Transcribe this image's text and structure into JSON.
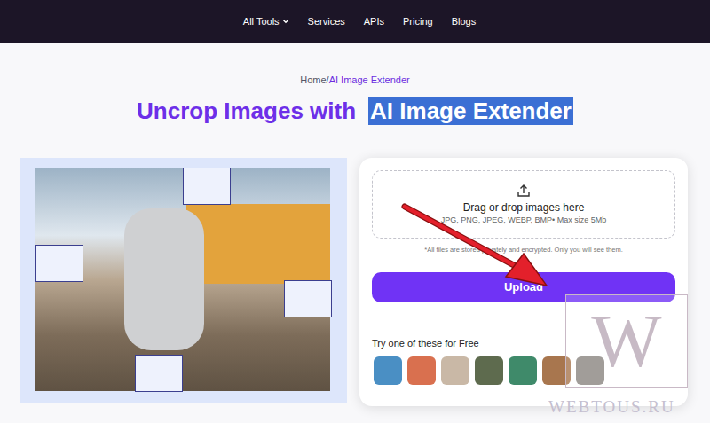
{
  "nav": {
    "items": [
      {
        "label": "All Tools",
        "dropdown": true
      },
      {
        "label": "Services",
        "dropdown": false
      },
      {
        "label": "APIs",
        "dropdown": false
      },
      {
        "label": "Pricing",
        "dropdown": false
      },
      {
        "label": "Blogs",
        "dropdown": false
      }
    ]
  },
  "breadcrumb": {
    "home": "Home",
    "separator": "/",
    "current": "AI Image Extender"
  },
  "title": {
    "prefix": "Uncrop Images with",
    "highlight": "AI Image Extender",
    "highlight_selected": true
  },
  "upload": {
    "drop_title": "Drag or drop images here",
    "formats": "JPG, PNG, JPEG, WEBP, BMP• Max size 5Mb",
    "privacy": "*All files are stored privately and encrypted. Only you will see them.",
    "button": "Upload"
  },
  "samples": {
    "title": "Try one of these for Free",
    "items": [
      {
        "color": "#4a8fc4"
      },
      {
        "color": "#d9704f"
      },
      {
        "color": "#c9b8a6"
      },
      {
        "color": "#5e6b4e"
      },
      {
        "color": "#3f8a6a"
      },
      {
        "color": "#a8764e"
      },
      {
        "color": "#8a8580"
      }
    ]
  },
  "watermark": {
    "letter": "W",
    "site": "WEBTOUS.RU"
  }
}
